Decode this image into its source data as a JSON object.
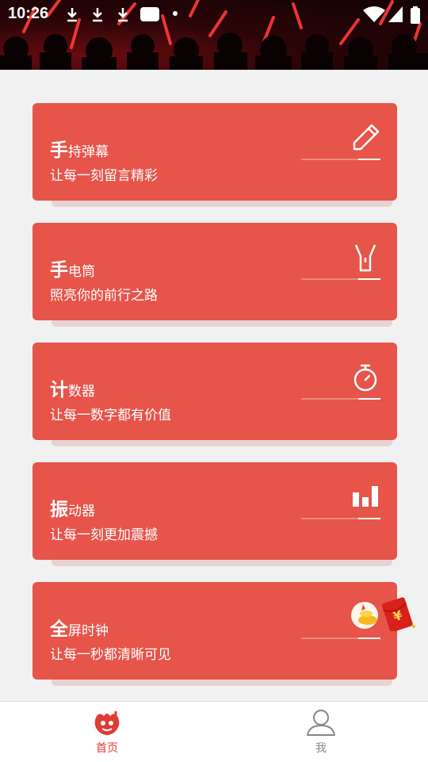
{
  "status_bar": {
    "time": "10:26"
  },
  "cards": [
    {
      "title_first": "手",
      "title_rest": "持弹幕",
      "subtitle": "让每一刻留言精彩",
      "icon": "pencil-icon"
    },
    {
      "title_first": "手",
      "title_rest": "电筒",
      "subtitle": "照亮你的前行之路",
      "icon": "flashlight-icon"
    },
    {
      "title_first": "计",
      "title_rest": "数器",
      "subtitle": "让每一数字都有价值",
      "icon": "stopwatch-icon"
    },
    {
      "title_first": "振",
      "title_rest": "动器",
      "subtitle": "让每一刻更加震撼",
      "icon": "bar-chart-icon"
    },
    {
      "title_first": "全",
      "title_rest": "屏时钟",
      "subtitle": "让每一秒都清晰可见",
      "icon": "red-envelope-icon"
    }
  ],
  "bottom_nav": [
    {
      "label": "首页",
      "icon": "home-mascot-icon",
      "active": true,
      "color": "#e03b34"
    },
    {
      "label": "我",
      "icon": "user-icon",
      "active": false,
      "color": "#888888"
    }
  ],
  "colors": {
    "card": "#e6544a",
    "background": "#f1f1f1",
    "accent": "#e03b34"
  }
}
